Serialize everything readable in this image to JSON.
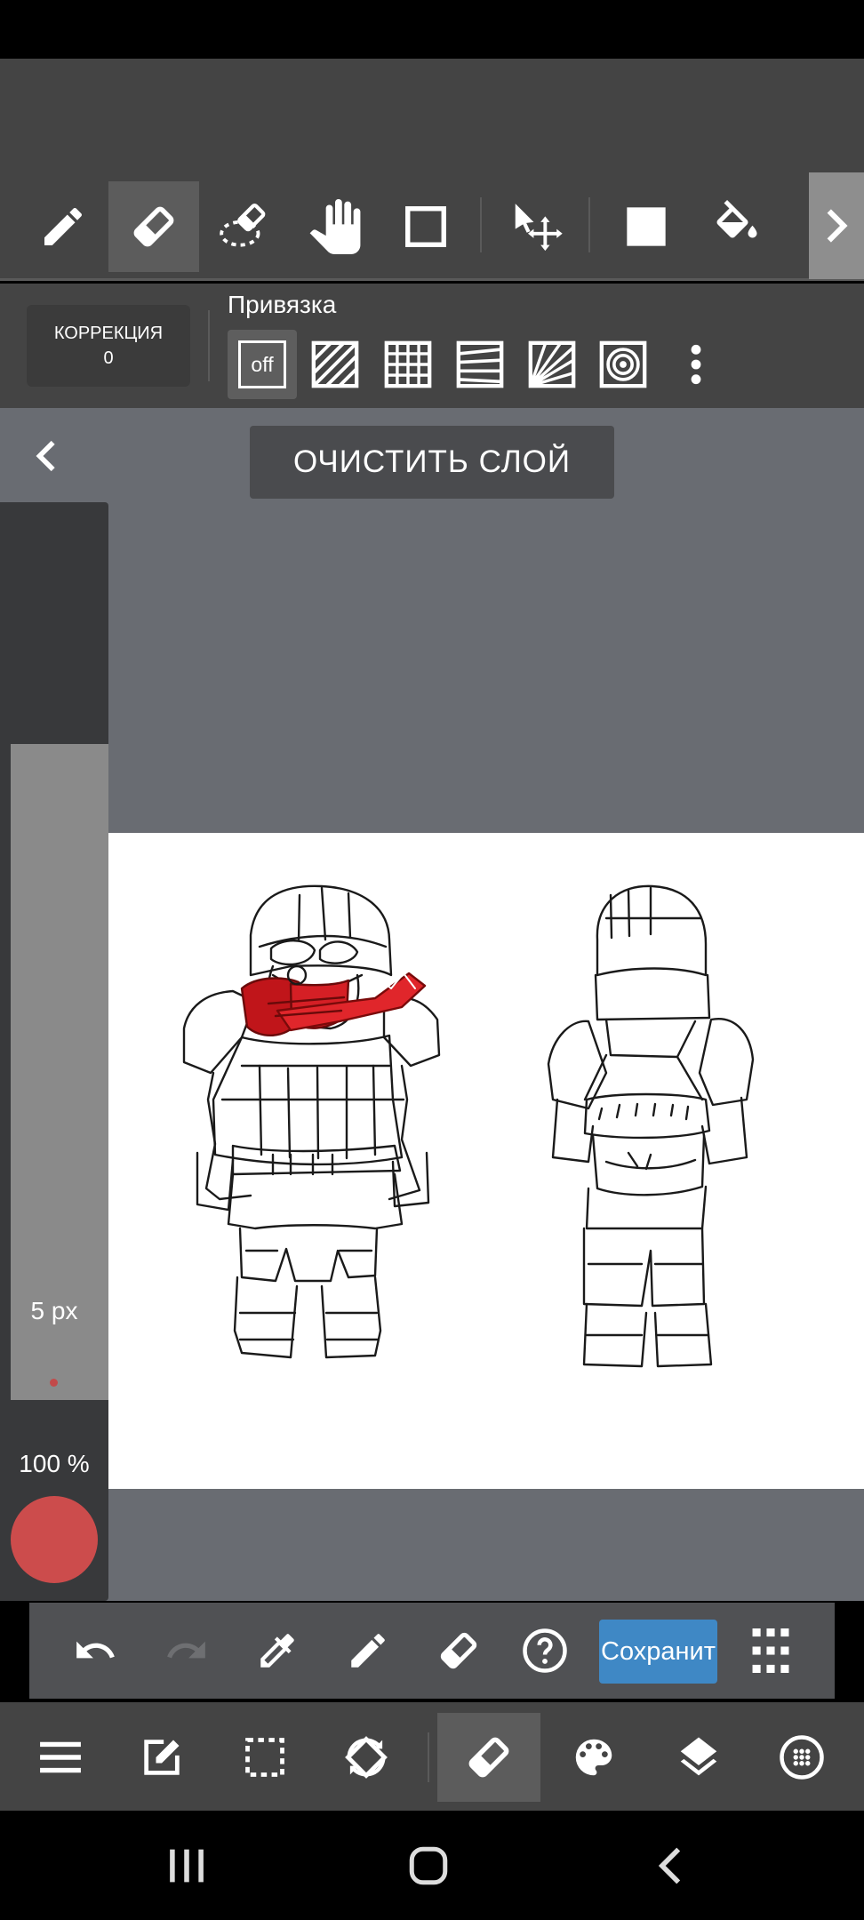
{
  "toolbar": {
    "tools": [
      "pencil-icon",
      "eraser-icon",
      "lasso-eraser-icon",
      "hand-icon",
      "rectangle-icon",
      "move-icon",
      "fill-color-icon",
      "paint-bucket-icon"
    ],
    "active_tool": "eraser-icon"
  },
  "correction": {
    "label": "КОРРЕКЦИЯ",
    "value": "0"
  },
  "snap": {
    "title": "Привязка",
    "off_label": "off",
    "options": [
      "parallel-snap-icon",
      "grid-snap-icon",
      "perspective-snap-icon",
      "radial-line-snap-icon",
      "circle-snap-icon"
    ]
  },
  "canvas": {
    "clear_layer_label": "ОЧИСТИТЬ СЛОЙ"
  },
  "brush": {
    "size_label": "5 px",
    "opacity_label": "100 %",
    "color": "#cc4c4c"
  },
  "actions": {
    "save_label": "Сохранит"
  },
  "menubar": {
    "items": [
      "menu-icon",
      "edit-icon",
      "selection-icon",
      "transform-icon",
      "eraser-icon",
      "palette-icon",
      "layers-icon",
      "material-icon"
    ],
    "active": "eraser-icon"
  },
  "colors": {
    "accent": "#3f88c5",
    "bar": "#444444",
    "canvas_bg": "#696c72",
    "brush": "#cc4c4c"
  }
}
